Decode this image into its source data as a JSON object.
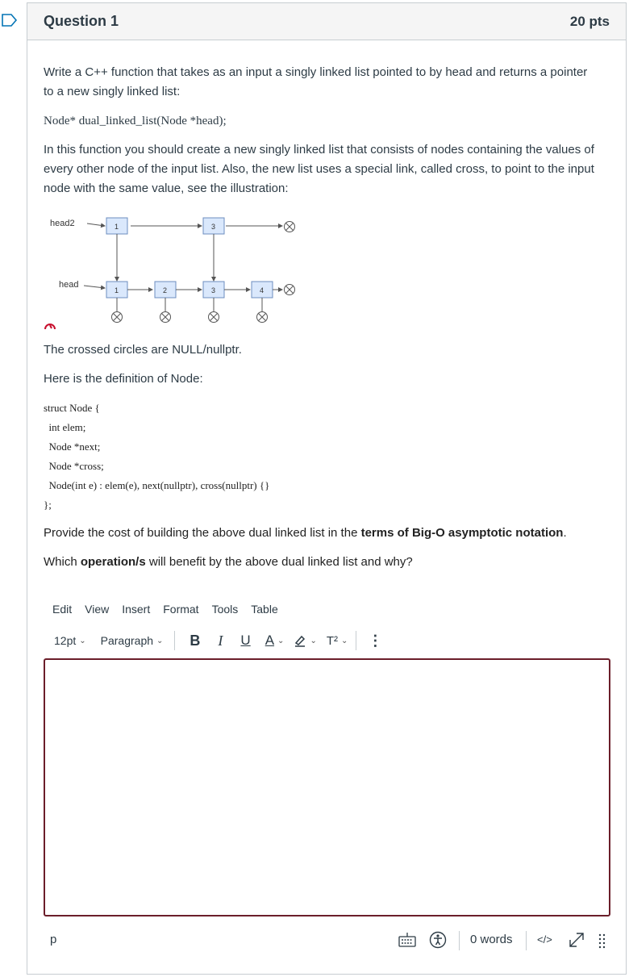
{
  "question": {
    "title": "Question 1",
    "points": "20 pts"
  },
  "body": {
    "p1": "Write a C++ function that takes as an input a singly linked list pointed to by head and returns a pointer to a new singly linked list:",
    "signature": "Node* dual_linked_list(Node *head);",
    "p2": "In this function you should create a new singly linked list that consists of nodes containing the values of every other node of the input list. Also, the new list uses a special link, called cross, to point to the input node with the same value, see the illustration:",
    "diagram": {
      "head2_label": "head2",
      "head_label": "head",
      "top_nodes": [
        "1",
        "3"
      ],
      "bottom_nodes": [
        "1",
        "2",
        "3",
        "4"
      ]
    },
    "crossed_note": "The crossed circles are NULL/nullptr.",
    "def_intro": "Here is the definition of Node:",
    "code": [
      "struct Node {",
      "  int elem;",
      "  Node *next;",
      "  Node *cross;",
      "  Node(int e) : elem(e), next(nullptr), cross(nullptr) {}",
      "};"
    ],
    "cost_prefix": "Provide the cost of building the above dual linked list in the ",
    "cost_bold": "terms of Big-O asymptotic notation",
    "cost_suffix": ".",
    "ops_prefix": "Which ",
    "ops_bold": "operation/s",
    "ops_suffix": " will benefit by the above dual linked list and why?"
  },
  "editor": {
    "menu": [
      "Edit",
      "View",
      "Insert",
      "Format",
      "Tools",
      "Table"
    ],
    "font_size": "12pt",
    "block_format": "Paragraph",
    "bold": "B",
    "italic": "I",
    "underline": "U",
    "text_color": "A",
    "superscript": "T²",
    "more": "⋮",
    "content": "",
    "path": "p",
    "word_count": "0 words",
    "html_toggle": "</>"
  },
  "colors": {
    "accent": "#6b1e2a",
    "node_fill": "#dae8fc",
    "node_stroke": "#6c8ebf",
    "flag": "#0374b5"
  }
}
